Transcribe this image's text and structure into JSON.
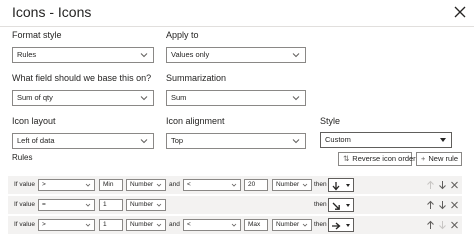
{
  "dialog": {
    "title": "Icons - Icons"
  },
  "format_style": {
    "label": "Format style",
    "value": "Rules"
  },
  "apply_to": {
    "label": "Apply to",
    "value": "Values only"
  },
  "field": {
    "label": "What field should we base this on?",
    "value": "Sum of qty"
  },
  "summarization": {
    "label": "Summarization",
    "value": "Sum"
  },
  "icon_layout": {
    "label": "Icon layout",
    "value": "Left of data"
  },
  "icon_alignment": {
    "label": "Icon alignment",
    "value": "Top"
  },
  "style": {
    "label": "Style",
    "value": "Custom"
  },
  "rules_section": {
    "label": "Rules",
    "reverse_button": "Reverse icon order",
    "new_rule_button": "New rule"
  },
  "rules": [
    {
      "if_value": "If value",
      "op1": ">",
      "val1": "",
      "type1": "Min",
      "unit1": "Number",
      "and": "and",
      "op2": "<",
      "val2": "20",
      "unit2": "Number",
      "then": "then",
      "icon": "arrow-down-icon"
    },
    {
      "if_value": "If value",
      "op1": "=",
      "val1": "1",
      "unit1": "Number",
      "then": "then",
      "icon": "arrow-down-right-icon"
    },
    {
      "if_value": "If value",
      "op1": ">",
      "val1": "1",
      "unit1": "Number",
      "and": "and",
      "op2": "<",
      "type2": "Max",
      "unit2": "Number",
      "then": "then",
      "icon": "arrow-right-icon"
    }
  ],
  "colors": {
    "border": "#8a8886",
    "row_bg": "#f3f2f1",
    "text": "#252423"
  }
}
